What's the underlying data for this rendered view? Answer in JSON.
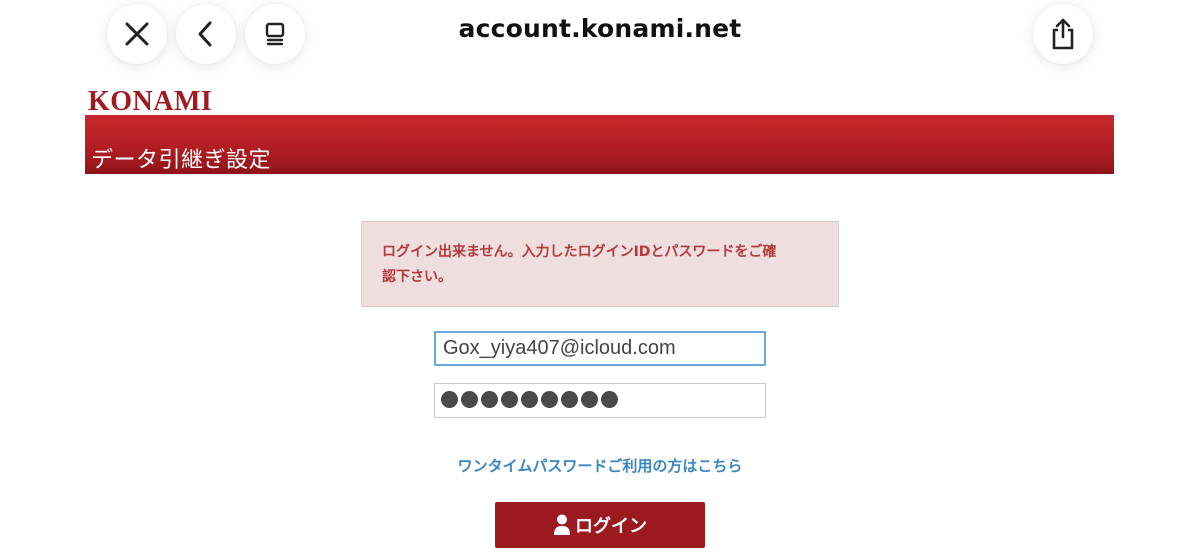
{
  "browser": {
    "url": "account.konami.net",
    "buttons": {
      "close_icon": "close-icon",
      "back_icon": "chevron-left-icon",
      "tabs_icon": "tabs-icon",
      "share_icon": "share-icon"
    }
  },
  "brand": {
    "logo_text": "KONAMI",
    "color": "#a11a22"
  },
  "page": {
    "title": "データ引継ぎ設定"
  },
  "error": {
    "line1": "ログイン出来ません。入力したログインIDとパスワードをご確",
    "line2": "認下さい。"
  },
  "form": {
    "login_id_value": "Gox_yiya407@icloud.com",
    "password_masked_length": 9,
    "onetime_link": "ワンタイムパスワードご利用の方はこちら",
    "login_button": "ログイン",
    "login_icon": "user-icon"
  },
  "colors": {
    "header_red": "#b21e24",
    "button_red": "#9a1a1f",
    "error_bg": "#efdede",
    "error_text": "#b33a3a",
    "link_blue": "#3a86c0",
    "focus_blue": "#6aa8de"
  }
}
